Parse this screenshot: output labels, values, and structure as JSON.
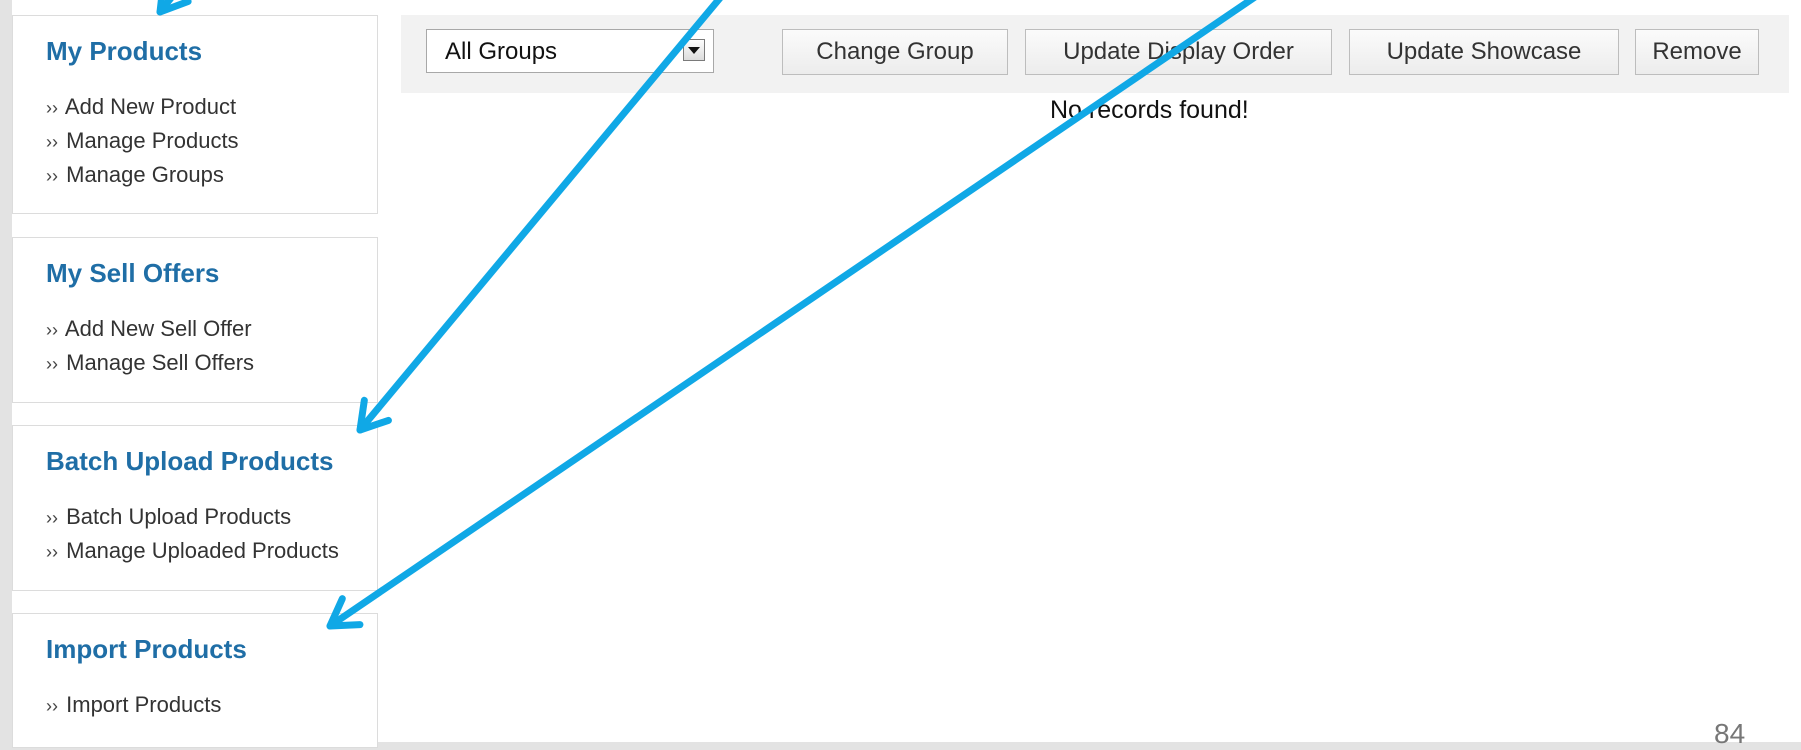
{
  "sidebar": {
    "my_products": {
      "title": "My Products",
      "links": [
        "Add New Product",
        "Manage Products",
        "Manage Groups"
      ]
    },
    "my_sell_offers": {
      "title": "My Sell Offers",
      "links": [
        "Add New Sell Offer",
        "Manage Sell Offers"
      ]
    },
    "batch_upload": {
      "title": "Batch Upload Products",
      "links": [
        "Batch Upload Products",
        "Manage Uploaded Products"
      ]
    },
    "import_products": {
      "title": "Import Products",
      "links": [
        "Import Products"
      ]
    },
    "link_prefix": "››"
  },
  "toolbar": {
    "group_select": "All Groups",
    "change_group": "Change Group",
    "update_display_order": "Update Display Order",
    "update_showcase": "Update Showcase",
    "remove": "Remove"
  },
  "main": {
    "empty_message": "No records found!"
  },
  "footer": {
    "page_number": "84"
  },
  "annotation": {
    "arrow_color": "#10a8e6"
  }
}
